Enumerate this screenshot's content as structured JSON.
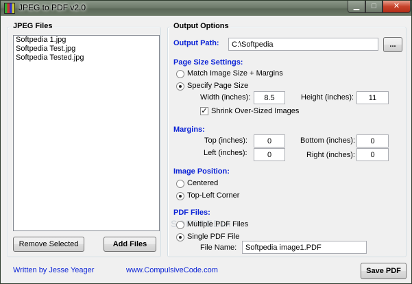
{
  "window": {
    "title": "JPEG to PDF  v2.0",
    "min_glyph": "▁",
    "max_glyph": "□",
    "close_glyph": "✕"
  },
  "jpeg_files": {
    "group_title": "JPEG Files",
    "items": [
      "Softpedia 1.jpg",
      "Softpedia Test.jpg",
      "Softpedia Tested.jpg"
    ],
    "remove_label": "Remove Selected",
    "add_label": "Add Files"
  },
  "output_options": {
    "group_title": "Output Options",
    "output_path_label": "Output Path:",
    "output_path_value": "C:\\Softpedia",
    "browse_label": "...",
    "page_size": {
      "heading": "Page Size Settings:",
      "match_label": "Match Image Size + Margins",
      "specify_label": "Specify Page Size",
      "selected": "specify",
      "width_label": "Width (inches):",
      "width_value": "8.5",
      "height_label": "Height (inches):",
      "height_value": "11",
      "shrink_label": "Shrink Over-Sized Images",
      "shrink_checked": true,
      "check_glyph": "✓"
    },
    "margins": {
      "heading": "Margins:",
      "top_label": "Top (inches):",
      "top_value": "0",
      "bottom_label": "Bottom (inches):",
      "bottom_value": "0",
      "left_label": "Left (inches):",
      "left_value": "0",
      "right_label": "Right (inches):",
      "right_value": "0"
    },
    "image_position": {
      "heading": "Image Position:",
      "centered_label": "Centered",
      "topleft_label": "Top-Left Corner",
      "selected": "top-left"
    },
    "pdf_files": {
      "heading": "PDF Files:",
      "multiple_label": "Multiple PDF Files",
      "single_label": "Single PDF File",
      "selected": "single",
      "filename_label": "File Name:",
      "filename_value": "Softpedia image1.PDF"
    }
  },
  "footer": {
    "author": "Written by Jesse Yeager",
    "website": "www.CompulsiveCode.com",
    "save_label": "Save PDF"
  },
  "watermark": "SOFTPEDIA"
}
